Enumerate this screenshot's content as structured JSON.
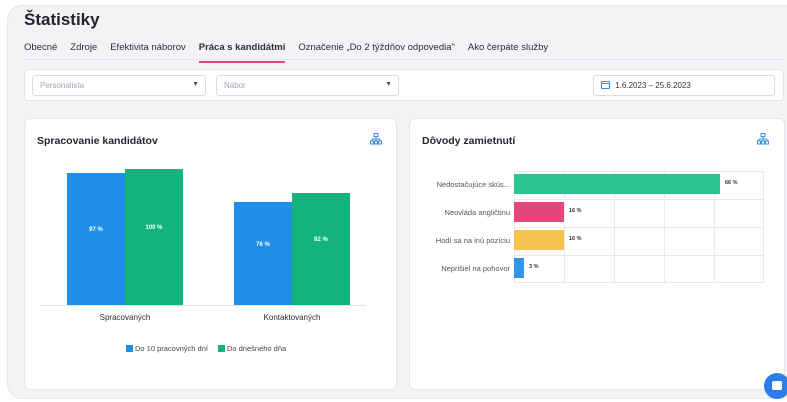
{
  "page": {
    "title": "Štatistiky"
  },
  "tabs": [
    {
      "label": "Obecné",
      "active": false
    },
    {
      "label": "Zdroje",
      "active": false
    },
    {
      "label": "Efektivita náborov",
      "active": false
    },
    {
      "label": "Práca s kandidátmi",
      "active": true
    },
    {
      "label": "Označenie „Do 2 týždňov odpovedia\"",
      "active": false
    },
    {
      "label": "Ako čerpáte služby",
      "active": false
    }
  ],
  "filters": {
    "recruiter_placeholder": "Personalista",
    "recruitment_placeholder": "Nábor",
    "date_range": "1.6.2023 – 25.6.2023"
  },
  "card_left": {
    "title": "Spracovanie kandidátov",
    "icon": "org-chart-icon"
  },
  "card_right": {
    "title": "Dôvody zamietnutí",
    "icon": "org-chart-icon"
  },
  "chart_data": [
    {
      "type": "bar",
      "title": "Spracovanie kandidátov",
      "categories": [
        "Spracovaných",
        "Kontaktovaných"
      ],
      "series": [
        {
          "name": "Do 10 pracovných dní",
          "values": [
            97,
            76
          ],
          "labels": [
            "97 %",
            "76 %"
          ],
          "color": "#1f8fe6"
        },
        {
          "name": "Do dnešného dňa",
          "values": [
            100,
            82
          ],
          "labels": [
            "100 %",
            "82 %"
          ],
          "color": "#14b27d"
        }
      ],
      "ylim": [
        0,
        100
      ],
      "legend": "bottom"
    },
    {
      "type": "bar",
      "orientation": "horizontal",
      "title": "Dôvody zamietnutí",
      "categories": [
        "Nedostačujúce skús...",
        "Neovláda angličtinu",
        "Hodí sa na inú pozíciu",
        "Neprišiel na pohovor"
      ],
      "values": [
        66,
        16,
        16,
        3
      ],
      "labels": [
        "66 %",
        "16 %",
        "16 %",
        "3 %"
      ],
      "colors": [
        "#2cc592",
        "#e5457a",
        "#f7c34f",
        "#2f97eb"
      ],
      "xlim": [
        0,
        100
      ]
    }
  ]
}
